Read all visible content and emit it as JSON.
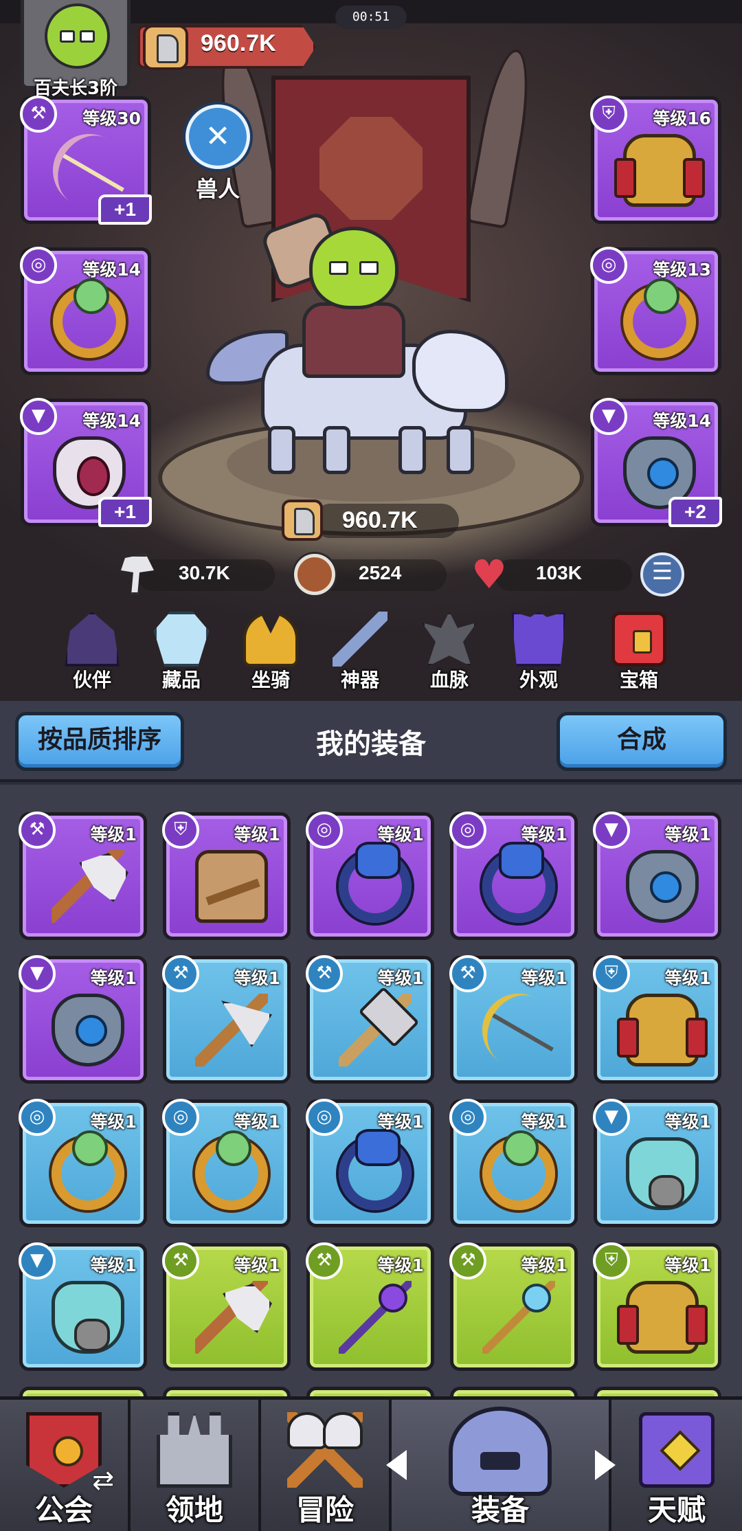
{
  "status": {
    "timer": "00:51"
  },
  "player": {
    "rank": "百夫长3阶",
    "power": "960.7K",
    "race": "兽人"
  },
  "hero": {
    "power": "960.7K"
  },
  "stats": {
    "attack": "30.7K",
    "defense": "2524",
    "hp": "103K"
  },
  "equipped": {
    "left": [
      {
        "slot": "axe-icon",
        "level": "等级30",
        "plus": "+1",
        "item": "bow"
      },
      {
        "slot": "ring-icon",
        "level": "等级14",
        "plus": "",
        "item": "ring"
      },
      {
        "slot": "necklace-icon",
        "level": "等级14",
        "plus": "+1",
        "item": "pendant"
      }
    ],
    "right": [
      {
        "slot": "armor-icon",
        "level": "等级16",
        "plus": "",
        "item": "armor"
      },
      {
        "slot": "ring-icon",
        "level": "等级13",
        "plus": "",
        "item": "ring"
      },
      {
        "slot": "necklace-icon",
        "level": "等级14",
        "plus": "+2",
        "item": "amulet"
      }
    ]
  },
  "features": [
    "伙伴",
    "藏品",
    "坐骑",
    "神器",
    "血脉",
    "外观",
    "宝箱"
  ],
  "panel": {
    "sort_button": "按品质排序",
    "title": "我的装备",
    "merge_button": "合成"
  },
  "inventory": [
    {
      "rarity": "purple",
      "slot": "axe-icon",
      "level": "等级1",
      "item": "axe"
    },
    {
      "rarity": "purple",
      "slot": "armor-icon",
      "level": "等级1",
      "item": "tunic"
    },
    {
      "rarity": "purple",
      "slot": "ring-icon",
      "level": "等级1",
      "item": "ring"
    },
    {
      "rarity": "purple",
      "slot": "ring-icon",
      "level": "等级1",
      "item": "ring"
    },
    {
      "rarity": "purple",
      "slot": "necklace-icon",
      "level": "等级1",
      "item": "amulet"
    },
    {
      "rarity": "purple",
      "slot": "necklace-icon",
      "level": "等级1",
      "item": "amulet"
    },
    {
      "rarity": "blue",
      "slot": "axe-icon",
      "level": "等级1",
      "item": "battleaxe"
    },
    {
      "rarity": "blue",
      "slot": "axe-icon",
      "level": "等级1",
      "item": "hammer"
    },
    {
      "rarity": "blue",
      "slot": "axe-icon",
      "level": "等级1",
      "item": "bow"
    },
    {
      "rarity": "blue",
      "slot": "armor-icon",
      "level": "等级1",
      "item": "armor"
    },
    {
      "rarity": "blue",
      "slot": "ring-icon",
      "level": "等级1",
      "item": "gring"
    },
    {
      "rarity": "blue",
      "slot": "ring-icon",
      "level": "等级1",
      "item": "gring"
    },
    {
      "rarity": "blue",
      "slot": "ring-icon",
      "level": "等级1",
      "item": "ring"
    },
    {
      "rarity": "blue",
      "slot": "ring-icon",
      "level": "等级1",
      "item": "gring"
    },
    {
      "rarity": "blue",
      "slot": "necklace-icon",
      "level": "等级1",
      "item": "mask"
    },
    {
      "rarity": "blue",
      "slot": "necklace-icon",
      "level": "等级1",
      "item": "mask"
    },
    {
      "rarity": "green",
      "slot": "axe-icon",
      "level": "等级1",
      "item": "axe"
    },
    {
      "rarity": "green",
      "slot": "axe-icon",
      "level": "等级1",
      "item": "staff"
    },
    {
      "rarity": "green",
      "slot": "axe-icon",
      "level": "等级1",
      "item": "staff2"
    },
    {
      "rarity": "green",
      "slot": "armor-icon",
      "level": "等级1",
      "item": "armor"
    }
  ],
  "nav": [
    "公会",
    "领地",
    "冒险",
    "装备",
    "天赋"
  ],
  "colors": {
    "purple": "#9a4fdc",
    "blue": "#5cb4e0",
    "green": "#a3cc3c",
    "accent": "#5aaaf0"
  }
}
